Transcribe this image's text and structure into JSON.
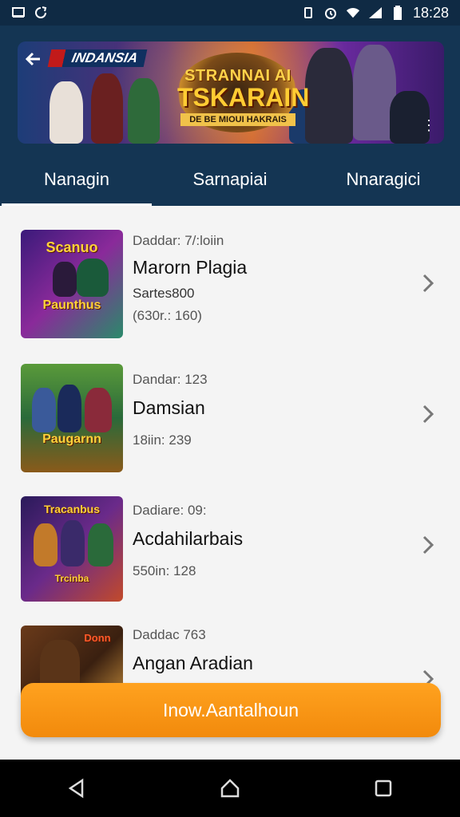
{
  "status_bar": {
    "time": "18:28",
    "icons": [
      "notification-icon",
      "sync-icon",
      "vibrate-icon",
      "alarm-icon",
      "wifi-icon",
      "signal-icon",
      "battery-icon"
    ]
  },
  "header": {
    "background": "#143553",
    "banner": {
      "brand": "INDANSIA",
      "title_line1": "STRANNAI AI",
      "title_line2": "TSKARAIN",
      "subtitle": "DE BE MIOUI HAKRAIS"
    },
    "tabs": [
      {
        "label": "Nanagin",
        "active": true
      },
      {
        "label": "Sarnapiai",
        "active": false
      },
      {
        "label": "Nnaragici",
        "active": false
      }
    ]
  },
  "list": {
    "items": [
      {
        "meta_top": "Daddar: 7/:loiin",
        "name": "Marorn Plagia",
        "meta_mid": "Sartes800",
        "meta_bottom": "(630r.: 160)",
        "thumb_logo_top": "Scanuo",
        "thumb_logo": "Paunthus"
      },
      {
        "meta_top": "Dandar: 123",
        "name": "Damsian",
        "meta_mid": "",
        "meta_bottom": "18iin: 239",
        "thumb_logo_top": "",
        "thumb_logo": "Paugarnn"
      },
      {
        "meta_top": "Dadiare: 09:",
        "name": "Acdahilarbais",
        "meta_mid": "",
        "meta_bottom": "550in: 128",
        "thumb_logo_top": "Tracanbus",
        "thumb_logo": "Trcinba"
      },
      {
        "meta_top": "Daddac 763",
        "name": "Angan Aradian",
        "meta_mid": "",
        "meta_bottom": "",
        "thumb_logo_top": "Donn",
        "thumb_logo": ""
      }
    ]
  },
  "action_button": {
    "label": "Inow.Aantalhoun",
    "color": "#f28a0c"
  },
  "nav_bar": {
    "buttons": [
      "back-icon",
      "home-icon",
      "recents-icon"
    ]
  }
}
